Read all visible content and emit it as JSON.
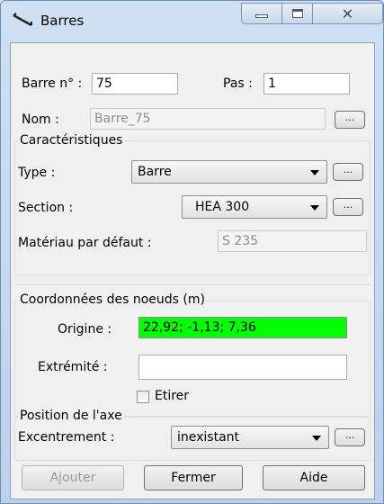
{
  "window": {
    "title": "Barres",
    "close_glyph": "✕"
  },
  "top": {
    "barre_label": "Barre n° :",
    "barre_value": "75",
    "pas_label": "Pas :",
    "pas_value": "1",
    "nom_label": "Nom :",
    "nom_value": "Barre_75",
    "nom_button": "..."
  },
  "caracteristiques": {
    "title": "Caractéristiques",
    "type_label": "Type :",
    "type_value": "Barre",
    "type_button": "...",
    "section_label": "Section :",
    "section_value": "HEA 300",
    "section_button": "...",
    "materiau_label": "Matériau par défaut :",
    "materiau_value": "S 235"
  },
  "coordonnees": {
    "title": "Coordonnées des noeuds (m)",
    "origine_label": "Origine :",
    "origine_value": "22,92; -1,13; 7,36",
    "extremite_label": "Extrémité :",
    "extremite_value": "",
    "etirer_label": "Etirer",
    "etirer_checked": false
  },
  "axe": {
    "title": "Position de l'axe",
    "excentrement_label": "Excentrement :",
    "excentrement_value": "inexistant",
    "excentrement_button": "..."
  },
  "buttons": {
    "ajouter": "Ajouter",
    "fermer": "Fermer",
    "aide": "Aide"
  },
  "colors": {
    "origine_highlight": "#00ff00"
  }
}
